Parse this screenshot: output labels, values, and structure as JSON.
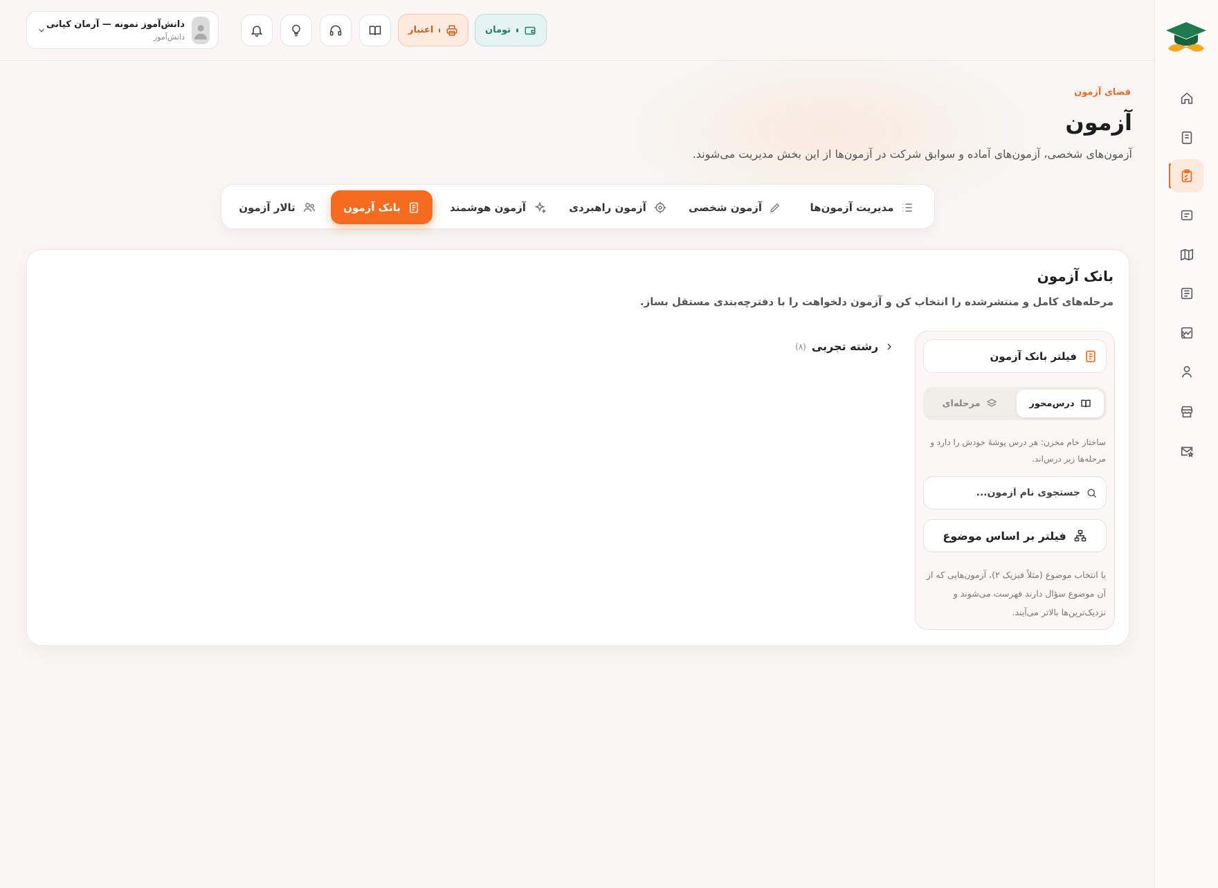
{
  "header": {
    "user": {
      "name": "دانش‌آموز نمونه — آرمان کیانی",
      "role": "دانش‌آموز"
    },
    "credit_label": "اعتبار",
    "wallet_label": "تومان"
  },
  "page": {
    "eyebrow": "فضای آزمون",
    "title": "آزمون",
    "description": "آزمون‌های شخصی، آزمون‌های آماده و سوابق شرکت در آزمون‌ها از این بخش مدیریت می‌شوند."
  },
  "tabs": [
    {
      "label": "مدیریت آزمون‌ها",
      "icon": "list-icon"
    },
    {
      "label": "آزمون شخصی",
      "icon": "pencil-icon"
    },
    {
      "label": "آزمون راهبردی",
      "icon": "target-icon"
    },
    {
      "label": "آزمون هوشمند",
      "icon": "sparkle-icon"
    },
    {
      "label": "بانک آزمون",
      "icon": "book-icon",
      "active": true
    },
    {
      "label": "تالار آزمون",
      "icon": "users-icon"
    }
  ],
  "card": {
    "title": "بانک آزمون",
    "subtitle": "مرحله‌های کامل و منتشرشده را انتخاب کن و آزمون دلخواهت را با دفترچه‌بندی مستقل بساز.",
    "crumb": {
      "label": "رشته تجربی",
      "count": "(۸)"
    }
  },
  "filter": {
    "title": "فیلتر بانک آزمون",
    "segments": [
      {
        "label": "درس‌محور",
        "active": true
      },
      {
        "label": "مرحله‌ای",
        "active": false
      }
    ],
    "note": "ساختار خام مخزن: هر درس پوشهٔ خودش را دارد و مرحله‌ها زیر درس‌اند.",
    "search_placeholder": "جستجوی نام آزمون...",
    "topic_button": "فیلتر بر اساس موضوع",
    "topic_note": "با انتخاب موضوع (مثلاً فیزیک ۲)، آزمون‌هایی که از آن موضوع سؤال دارند فهرست می‌شوند و نزدیک‌ترین‌ها بالاتر می‌آیند."
  },
  "sidebar": {
    "items": [
      {
        "icon": "home-icon"
      },
      {
        "icon": "notebook-icon"
      },
      {
        "icon": "clipboard-check-icon",
        "active": true
      },
      {
        "icon": "folder-icon"
      },
      {
        "icon": "map-icon"
      },
      {
        "icon": "newspaper-icon"
      },
      {
        "icon": "chart-icon"
      },
      {
        "icon": "user-icon"
      },
      {
        "icon": "store-icon"
      },
      {
        "icon": "mail-star-icon"
      }
    ]
  },
  "colors": {
    "accent": "#f56c1f",
    "credit": "#d35b1a",
    "wallet": "#1f7e67",
    "logo_green": "#1e7a4c",
    "logo_orange": "#f5a623"
  }
}
